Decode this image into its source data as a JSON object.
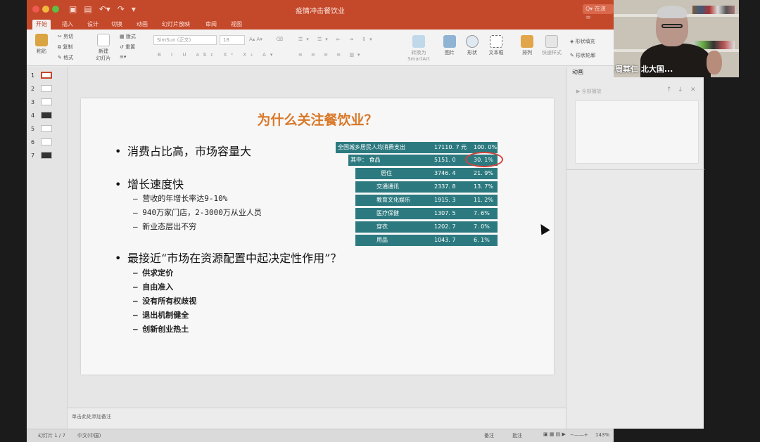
{
  "window": {
    "title": "疫情冲击餐饮业",
    "search": "Q▾ 在演示...",
    "colors": {
      "accent": "#c4482a",
      "table": "#2c7a80",
      "title_text": "#d97727",
      "circle": "#d3423c"
    }
  },
  "ribbon_tabs": [
    "开始",
    "插入",
    "设计",
    "切换",
    "动画",
    "幻灯片放映",
    "审阅",
    "视图"
  ],
  "ribbon": {
    "paste": "粘贴",
    "cut": "剪切",
    "copy": "复制",
    "format": "格式",
    "new_slide": "新建\n幻灯片",
    "layout": "版式",
    "reset": "重置",
    "font_name": "SimSun (正文)",
    "font_size": "18",
    "convert_smartart": "转换为\nSmartArt",
    "picture": "图片",
    "shape": "形状",
    "textbox": "文本框",
    "arrange": "排列",
    "quick_styles": "快速样式",
    "shape_fill": "形状填充",
    "shape_outline": "形状轮廓"
  },
  "slides_panel": [
    "1",
    "2",
    "3",
    "4",
    "5",
    "6",
    "7"
  ],
  "slide": {
    "title": "为什么关注餐饮业？",
    "bullets": [
      {
        "text": "消费占比高，市场容量大"
      },
      {
        "text": "增长速度快"
      },
      {
        "text": "最接近“市场在资源配置中起决定性作用”？"
      }
    ],
    "growth_subs": [
      "– 营收的年增长率达9-10%",
      "– 940万家门店，2-3000万从业人员",
      "– 新业态层出不穷"
    ],
    "market_subs": [
      "– 供求定价",
      "– 自由准入",
      "– 没有所有权歧视",
      "– 退出机制健全",
      "– 创新创业热土"
    ],
    "table": [
      {
        "label": "全国城乡居民人均消费支出",
        "value": "17110. 7 元",
        "pct": "100. 0%"
      },
      {
        "label": "其中：    食品",
        "value": "5151. 0",
        "pct": "30. 1%"
      },
      {
        "label": "居住",
        "value": "3746. 4",
        "pct": "21. 9%"
      },
      {
        "label": "交通通讯",
        "value": "2337. 8",
        "pct": "13. 7%"
      },
      {
        "label": "教育文化娱乐",
        "value": "1915. 3",
        "pct": "11. 2%"
      },
      {
        "label": "医疗保健",
        "value": "1307. 5",
        "pct": "7. 6%"
      },
      {
        "label": "穿衣",
        "value": "1202. 7",
        "pct": "7. 0%"
      },
      {
        "label": "用品",
        "value": "1043. 7",
        "pct": "6. 1%"
      }
    ]
  },
  "notes_placeholder": "单击此处添加备注",
  "status": {
    "slide_of": "幻灯片 1 / 7",
    "language": "中文(中国)",
    "notes_btn": "备注",
    "comments_btn": "批注",
    "zoom": "143%"
  },
  "animation_pane": {
    "title": "动画",
    "play_all": "▶ 全部播放"
  },
  "video": {
    "name": "周其仁 北大国..."
  }
}
